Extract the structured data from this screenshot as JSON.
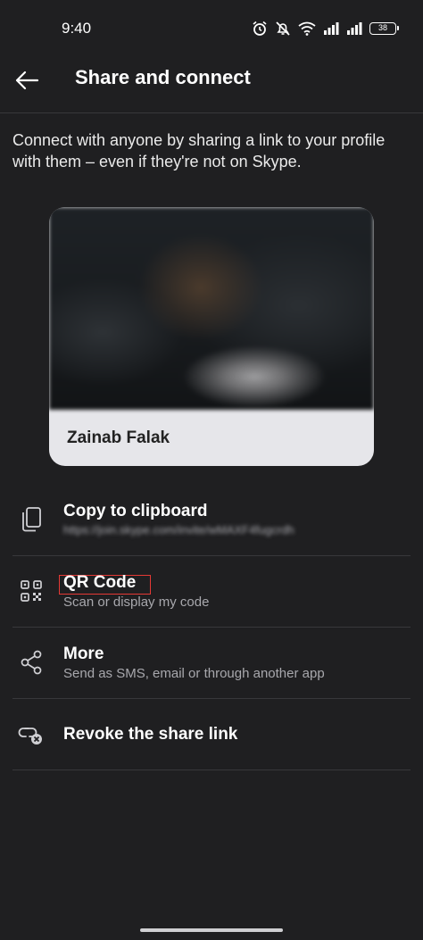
{
  "status_bar": {
    "time": "9:40",
    "battery": "38"
  },
  "header": {
    "title": "Share and connect"
  },
  "intro_text": "Connect with anyone by sharing a link to your profile with them – even if they're not on Skype.",
  "profile_card": {
    "name": "Zainab Falak"
  },
  "options": [
    {
      "label": "Copy to clipboard",
      "sub": "https://join.skype.com/invite/wMAXF4fugcrdh",
      "icon": "copy-icon"
    },
    {
      "label": "QR Code",
      "sub": "Scan or display my code",
      "icon": "qr-code-icon"
    },
    {
      "label": "More",
      "sub": "Send as SMS, email or through another app",
      "icon": "share-icon"
    },
    {
      "label": "Revoke the share link",
      "sub": "",
      "icon": "unlink-icon"
    }
  ],
  "colors": {
    "background": "#1f1f21",
    "divider": "#38383b",
    "card": "#e6e6ea",
    "highlight": "#e53935"
  }
}
